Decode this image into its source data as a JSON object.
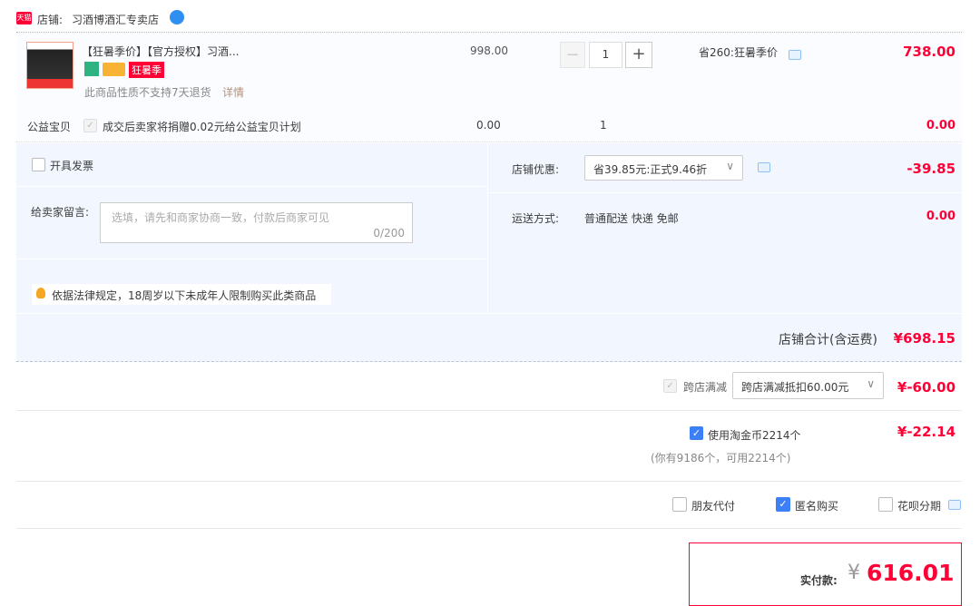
{
  "store": {
    "badge": "天猫",
    "label": "店铺:",
    "name": "习酒博酒汇专卖店"
  },
  "item": {
    "title": "【狂暑季价】【官方授权】习酒...",
    "tag": "狂暑季",
    "notice": "此商品性质不支持7天退货",
    "notice_link": "详情",
    "price": "998.00",
    "quantity": "1",
    "promo": "省260:狂暑季价",
    "subtotal": "738.00"
  },
  "charity": {
    "label": "公益宝贝",
    "text": "成交后卖家将捐赠0.02元给公益宝贝计划",
    "price": "0.00",
    "quantity": "1",
    "subtotal": "0.00"
  },
  "invoice": {
    "label": "开具发票"
  },
  "message": {
    "label": "给卖家留言:",
    "placeholder": "选填，请先和商家协商一致，付款后商家可见",
    "counter": "0/200"
  },
  "legal_note": "依据法律规定，18周岁以下未成年人限制购买此类商品",
  "shop_discount": {
    "label": "店铺优惠:",
    "selected": "省39.85元:正式9.46折",
    "amount": "-39.85"
  },
  "shipping": {
    "label": "运送方式:",
    "value": "普通配送 快递 免邮",
    "amount": "0.00"
  },
  "shop_total": {
    "label": "店铺合计(含运费)",
    "amount": "¥698.15"
  },
  "cross_store": {
    "label": "跨店满减",
    "selected": "跨店满减抵扣60.00元",
    "amount": "¥-60.00"
  },
  "coins": {
    "label": "使用淘金币2214个",
    "sub": "(你有9186个，可用2214个)",
    "amount": "¥-22.14"
  },
  "options": {
    "friend_pay": "朋友代付",
    "anonymous": "匿名购买",
    "huabei": "花呗分期"
  },
  "payment": {
    "label": "实付款:",
    "currency": "¥",
    "amount": "616.01"
  },
  "colors": {
    "accent": "#ff0036",
    "checkbox": "#3d7ff6"
  }
}
